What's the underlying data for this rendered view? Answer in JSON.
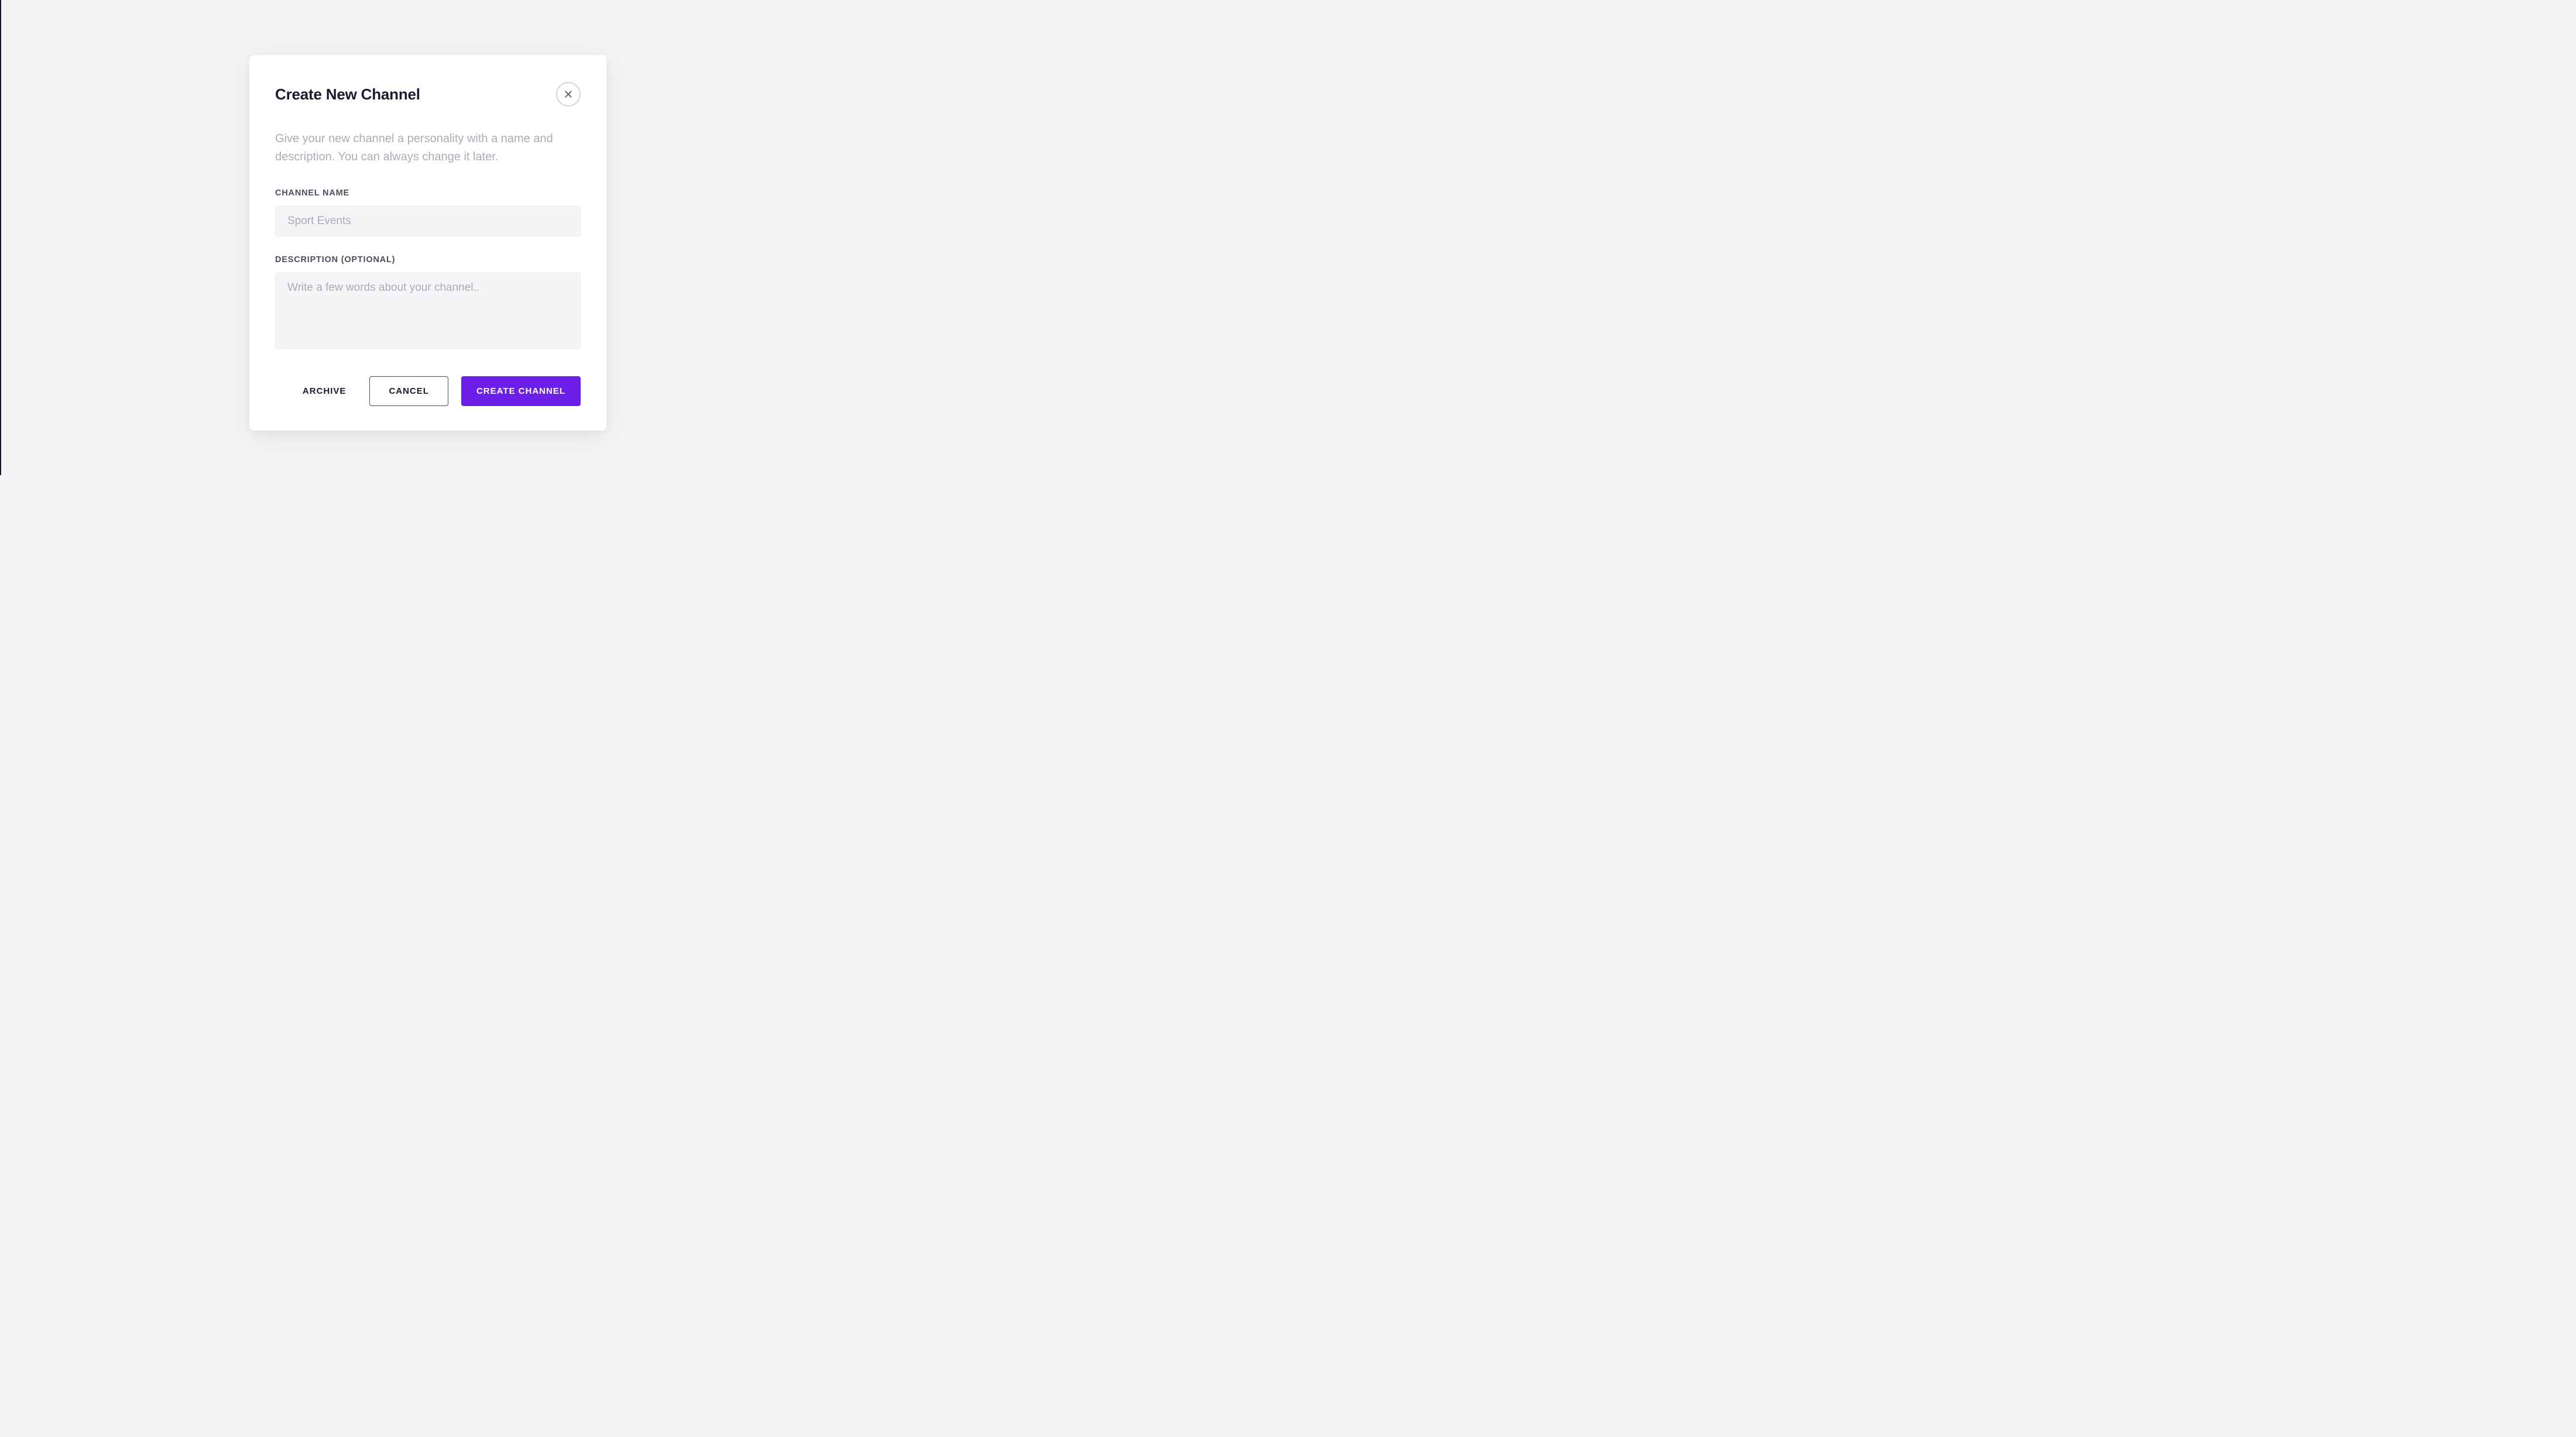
{
  "modal": {
    "title": "Create New Channel",
    "subtitle": "Give your new channel a personality with a name and description. You can always change it later.",
    "fields": {
      "name": {
        "label": "CHANNEL NAME",
        "placeholder": "Sport Events",
        "value": ""
      },
      "description": {
        "label": "DESCRIPTION (OPTIONAL)",
        "placeholder": "Write a few words about your channel..",
        "value": ""
      }
    },
    "actions": {
      "archive": "ARCHIVE",
      "cancel": "CANCEL",
      "create": "CREATE CHANNEL"
    }
  },
  "colors": {
    "primary": "#6b1fe8",
    "text_dark": "#1a1a2e",
    "text_muted": "#a9adb8",
    "bg": "#f3f4f6",
    "input_bg": "#f5f5f7"
  }
}
